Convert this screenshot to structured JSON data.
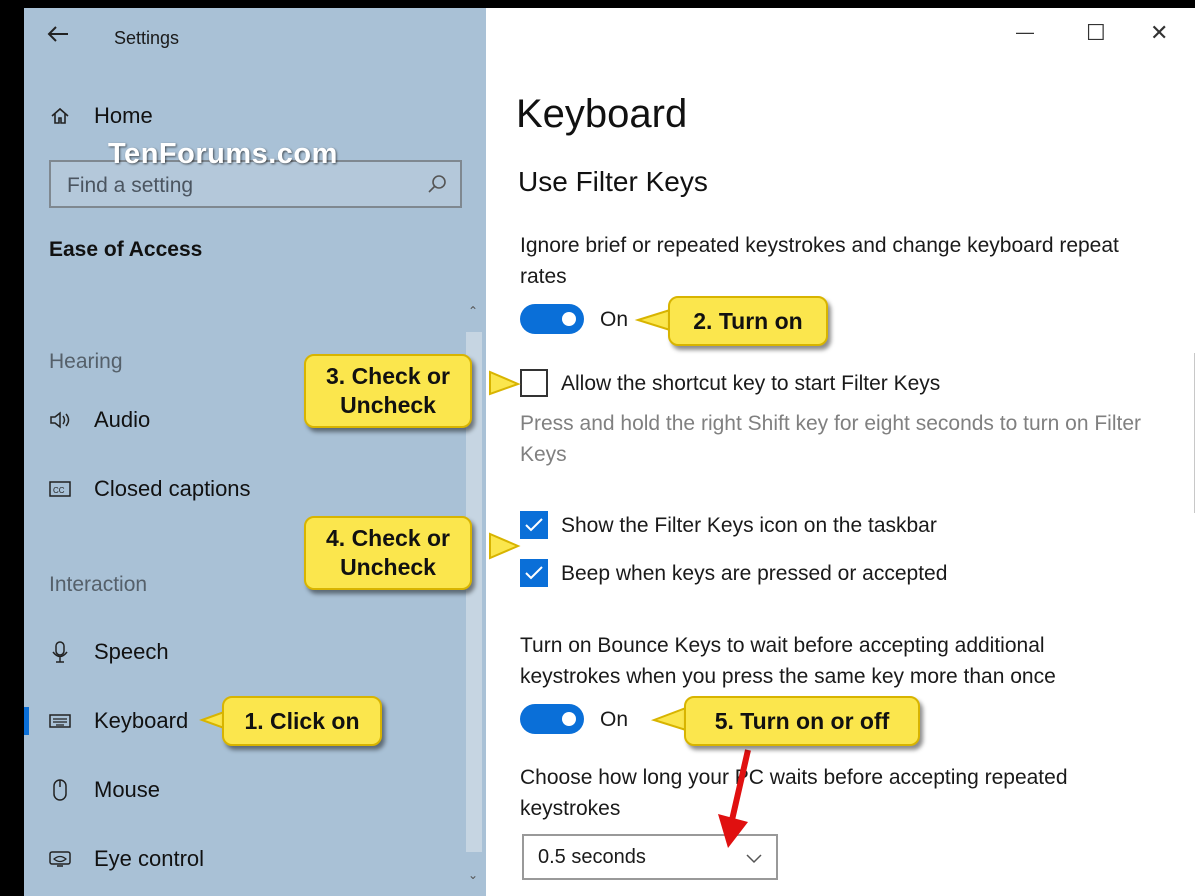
{
  "window": {
    "title": "Settings",
    "minimize_glyph": "—",
    "maximize_glyph": "☐",
    "close_glyph": "✕"
  },
  "watermark": "TenForums.com",
  "sidebar": {
    "home_label": "Home",
    "search": {
      "placeholder": "Find a setting",
      "icon": "search-icon"
    },
    "category": "Ease of Access",
    "sections": [
      {
        "heading": "Hearing",
        "items": [
          {
            "label": "Audio",
            "icon": "audio-icon"
          },
          {
            "label": "Closed captions",
            "icon": "closed-captions-icon"
          }
        ]
      },
      {
        "heading": "Interaction",
        "items": [
          {
            "label": "Speech",
            "icon": "microphone-icon"
          },
          {
            "label": "Keyboard",
            "icon": "keyboard-icon",
            "selected": true
          },
          {
            "label": "Mouse",
            "icon": "mouse-icon"
          },
          {
            "label": "Eye control",
            "icon": "eye-control-icon"
          }
        ]
      }
    ]
  },
  "main": {
    "page_title": "Keyboard",
    "section_title": "Use Filter Keys",
    "filter_keys_description": "Ignore brief or repeated keystrokes and change keyboard repeat rates",
    "filter_keys_toggle": {
      "state": "On",
      "on": true
    },
    "shortcut_checkbox": {
      "label": "Allow the shortcut key to start Filter Keys",
      "checked": false
    },
    "shortcut_help": "Press and hold the right Shift key for eight seconds to turn on Filter Keys",
    "taskbar_icon_checkbox": {
      "label": "Show the Filter Keys icon on the taskbar",
      "checked": true
    },
    "beep_checkbox": {
      "label": "Beep when keys are pressed or accepted",
      "checked": true
    },
    "bounce_keys_description": "Turn on Bounce Keys to wait before accepting additional keystrokes when you press the same key more than once",
    "bounce_keys_toggle": {
      "state": "On",
      "on": true
    },
    "repeat_wait_label": "Choose how long your PC waits before accepting repeated keystrokes",
    "repeat_wait_dropdown": {
      "value": "0.5 seconds"
    }
  },
  "callouts": {
    "step1": "1. Click on",
    "step2": "2. Turn on",
    "step3": "3. Check or\nUncheck",
    "step4": "4. Check or\nUncheck",
    "step5": "5. Turn on or off"
  },
  "colors": {
    "sidebar_bg": "#a9c1d6",
    "accent": "#0a6fd8",
    "callout_bg": "#fbe64d",
    "arrow": "#e01010"
  }
}
